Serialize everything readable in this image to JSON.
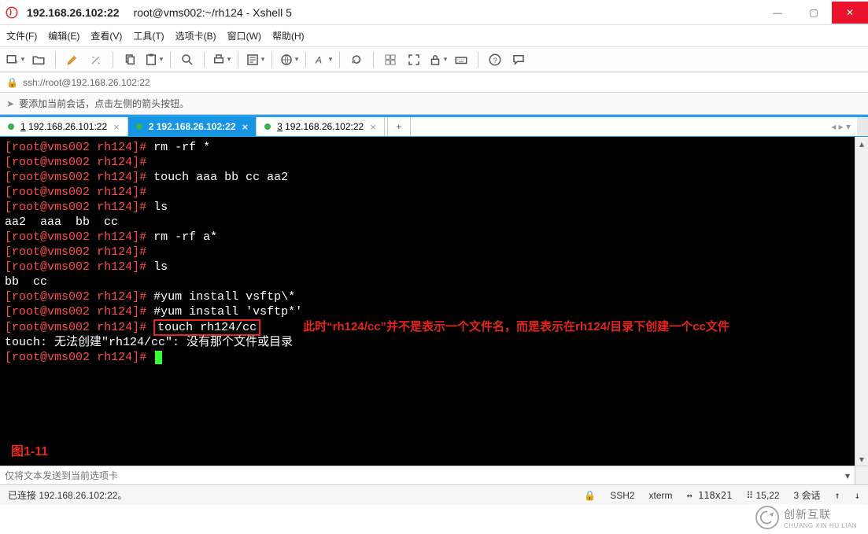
{
  "title": {
    "host": "192.168.26.102:22",
    "path": "root@vms002:~/rh124 - Xshell 5"
  },
  "menu": {
    "items": [
      "文件(F)",
      "编辑(E)",
      "查看(V)",
      "工具(T)",
      "选项卡(B)",
      "窗口(W)",
      "帮助(H)"
    ]
  },
  "toolbar": {
    "icons": [
      "new-tab",
      "open",
      "pen",
      "copy",
      "paste",
      "search",
      "print",
      "props",
      "globe",
      "font",
      "color",
      "lock",
      "fullscreen",
      "padlock",
      "keyboard",
      "help",
      "chat"
    ]
  },
  "url": "ssh://root@192.168.26.102:22",
  "infobar_text": "要添加当前会话，点击左侧的箭头按钮。",
  "tabs": [
    {
      "id": "1",
      "label": "1 192.168.26.101:22"
    },
    {
      "id": "2",
      "label": "2 192.168.26.102:22",
      "active": true
    },
    {
      "id": "3",
      "label": "3 192.168.26.102:22"
    }
  ],
  "terminal": {
    "prompt_user": "root",
    "prompt_host": "vms002",
    "prompt_dir": "rh124",
    "lines": [
      {
        "type": "prompt",
        "cmd": "rm -rf *"
      },
      {
        "type": "prompt",
        "cmd": ""
      },
      {
        "type": "prompt",
        "cmd": "touch aaa bb cc aa2"
      },
      {
        "type": "prompt",
        "cmd": ""
      },
      {
        "type": "prompt",
        "cmd": "ls"
      },
      {
        "type": "out",
        "text": "aa2  aaa  bb  cc"
      },
      {
        "type": "prompt",
        "cmd": "rm -rf a*"
      },
      {
        "type": "prompt",
        "cmd": ""
      },
      {
        "type": "prompt",
        "cmd": "ls"
      },
      {
        "type": "out",
        "text": "bb  cc"
      },
      {
        "type": "prompt",
        "cmd": "#yum install vsftp\\*"
      },
      {
        "type": "prompt",
        "cmd": "#yum install 'vsftp*'"
      },
      {
        "type": "prompt_boxed",
        "cmd": "touch rh124/cc",
        "anno": "此时“rh124/cc”并不是表示一个文件名，而是表示在rh124/目录下创建一个cc文件"
      },
      {
        "type": "out",
        "text": "touch: 无法创建\"rh124/cc\": 没有那个文件或目录"
      },
      {
        "type": "prompt_cursor"
      }
    ],
    "figure_label": "图1-11"
  },
  "sendbar_placeholder": "仅将文本发送到当前选项卡",
  "status": {
    "left": "已连接 192.168.26.102:22。",
    "proto": "SSH2",
    "term": "xterm",
    "size": "118x21",
    "pos": "15,22",
    "sessions": "3 会话"
  },
  "watermark": {
    "main": "创新互联",
    "sub": "CHUANG XIN HU LIAN"
  }
}
